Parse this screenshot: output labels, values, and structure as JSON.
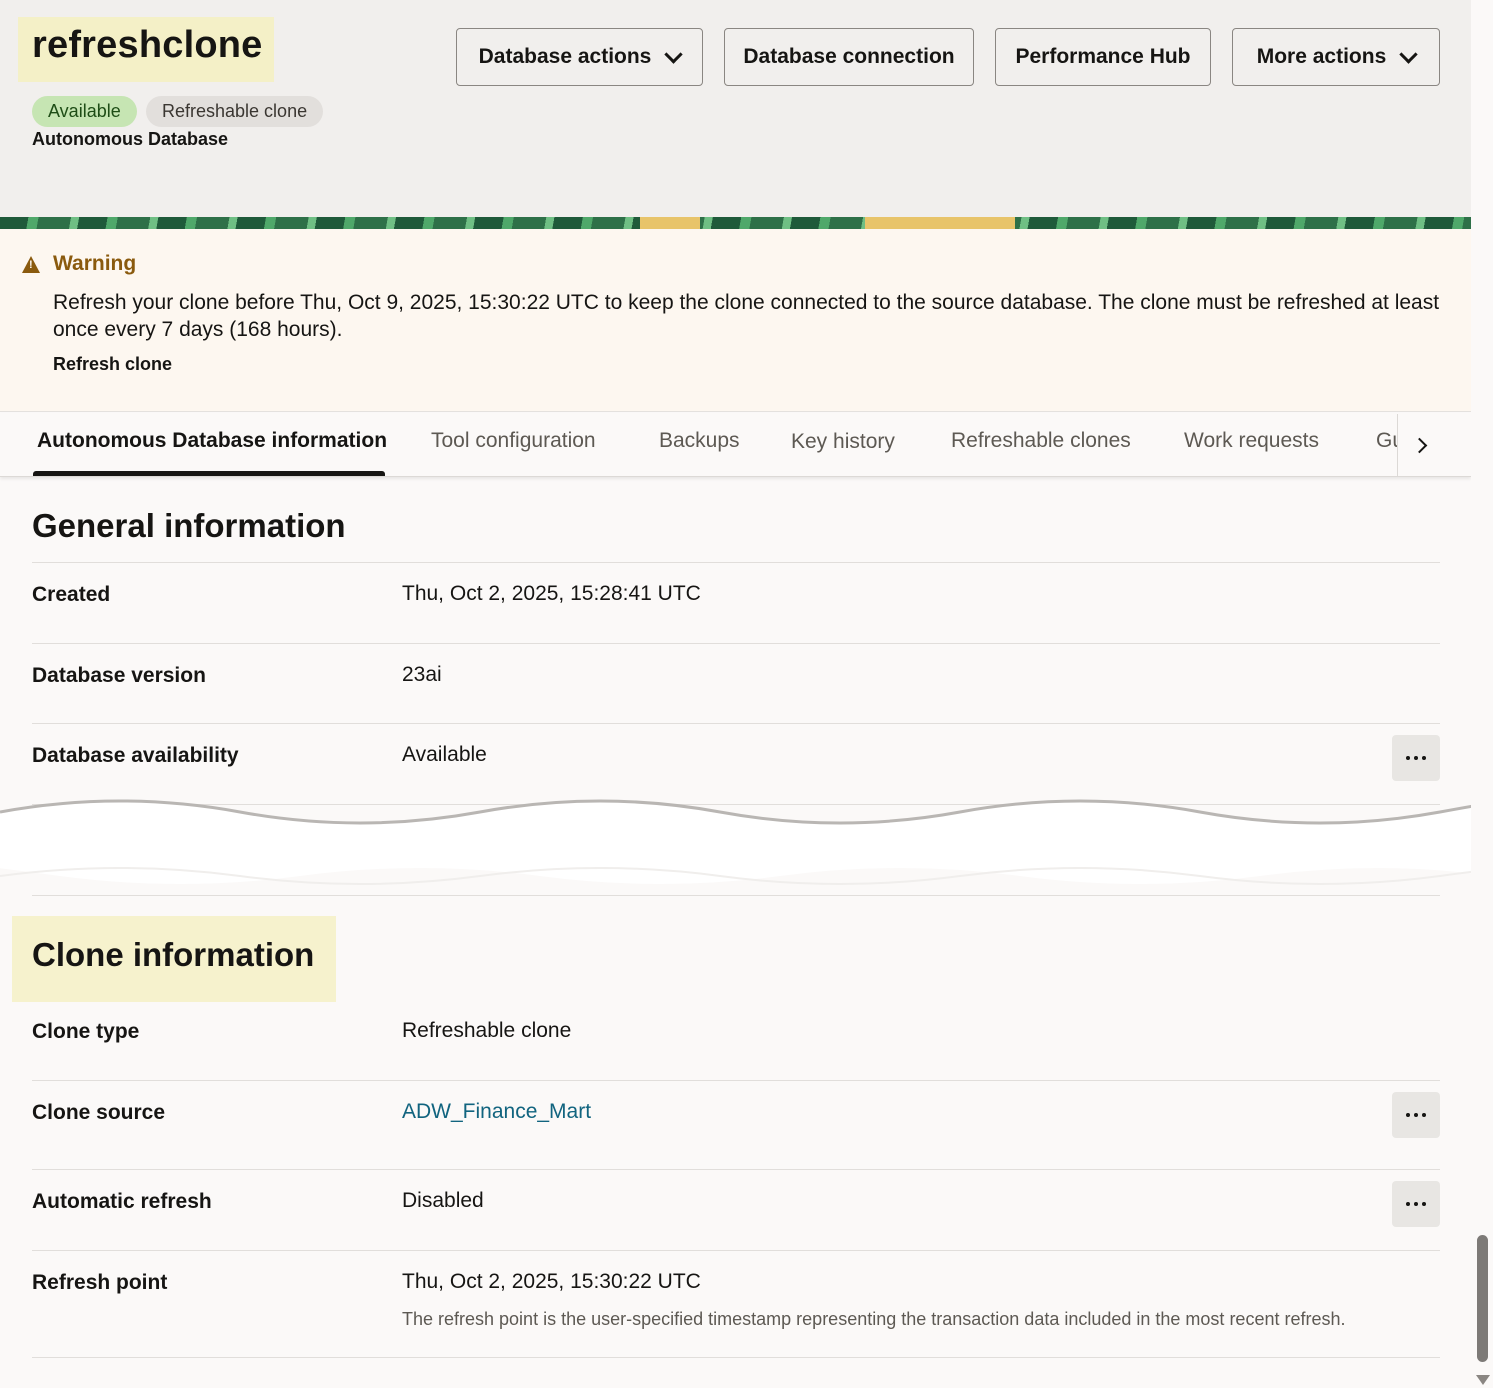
{
  "header": {
    "title": "refreshclone",
    "badges": [
      "Available",
      "Refreshable clone"
    ],
    "subtitle": "Autonomous Database",
    "buttons": {
      "database_actions": "Database actions",
      "database_connection": "Database connection",
      "performance_hub": "Performance Hub",
      "more_actions": "More actions"
    }
  },
  "warning": {
    "title": "Warning",
    "message": "Refresh your clone before Thu, Oct 9, 2025, 15:30:22 UTC to keep the clone connected to the source database. The clone must be refreshed at least once every 7 days (168 hours).",
    "action": "Refresh clone"
  },
  "tabs": [
    {
      "label": "Autonomous Database information",
      "active": true
    },
    {
      "label": "Tool configuration"
    },
    {
      "label": "Backups"
    },
    {
      "label": "Key history"
    },
    {
      "label": "Refreshable clones"
    },
    {
      "label": "Work requests"
    },
    {
      "label": "Gu"
    }
  ],
  "general": {
    "title": "General information",
    "rows": [
      {
        "label": "Created",
        "value": "Thu, Oct 2, 2025, 15:28:41 UTC"
      },
      {
        "label": "Database version",
        "value": "23ai"
      },
      {
        "label": "Database availability",
        "value": "Available"
      }
    ]
  },
  "clone": {
    "title": "Clone information",
    "rows": [
      {
        "label": "Clone type",
        "value": "Refreshable clone"
      },
      {
        "label": "Clone source",
        "value": "ADW_Finance_Mart"
      },
      {
        "label": "Automatic refresh",
        "value": "Disabled"
      },
      {
        "label": "Refresh point",
        "value": "Thu, Oct 2, 2025, 15:30:22 UTC",
        "help": "The refresh point is the user-specified timestamp representing the transaction data included in the most recent refresh."
      }
    ]
  },
  "icons": {
    "chevron": "chevron-down-icon",
    "warning": "warning-triangle-icon",
    "tab_next": "chevron-right-icon",
    "more": "more-horizontal-icon"
  },
  "colors": {
    "title_highlight": "#f4f0c7",
    "available_badge": "#c6e5b3",
    "warning_text": "#8a5a0e",
    "link": "#11647f"
  }
}
